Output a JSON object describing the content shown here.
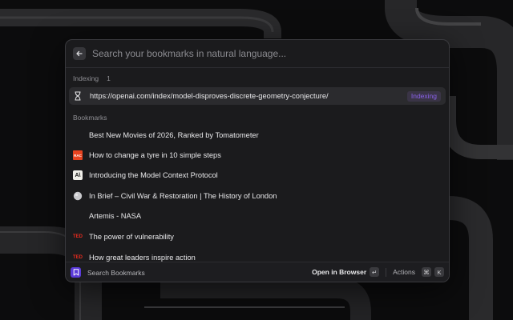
{
  "search": {
    "placeholder": "Search your bookmarks in natural language..."
  },
  "indexing": {
    "header": "Indexing",
    "count": "1",
    "url": "https://openai.com/index/model-disproves-discrete-geometry-conjecture/",
    "badge": "Indexing",
    "icon": "hourglass-icon"
  },
  "bookmarks": {
    "header": "Bookmarks",
    "items": [
      {
        "title": "Best New Movies of 2026, Ranked by Tomatometer",
        "icon": "none"
      },
      {
        "title": "How to change a tyre in 10 simple steps",
        "icon": "rac-favicon",
        "favicon_text": "RAC"
      },
      {
        "title": "Introducing the Model Context Protocol",
        "icon": "anthropic-favicon",
        "favicon_text": "A\\"
      },
      {
        "title": "In Brief – Civil War & Restoration | The History of London",
        "icon": "globe-favicon"
      },
      {
        "title": "Artemis - NASA",
        "icon": "none"
      },
      {
        "title": "The power of vulnerability",
        "icon": "ted-favicon",
        "favicon_text": "TED"
      },
      {
        "title": "How great leaders inspire action",
        "icon": "ted-favicon",
        "favicon_text": "TED"
      }
    ]
  },
  "footer": {
    "title": "Search Bookmarks",
    "primary_action": "Open in Browser",
    "primary_key": "↵",
    "secondary_action": "Actions",
    "secondary_keys": [
      "⌘",
      "K"
    ]
  },
  "colors": {
    "accent": "#8b62ea",
    "brand": "#5b3bd9",
    "rac": "#e8431f",
    "ted": "#e62b1e"
  }
}
